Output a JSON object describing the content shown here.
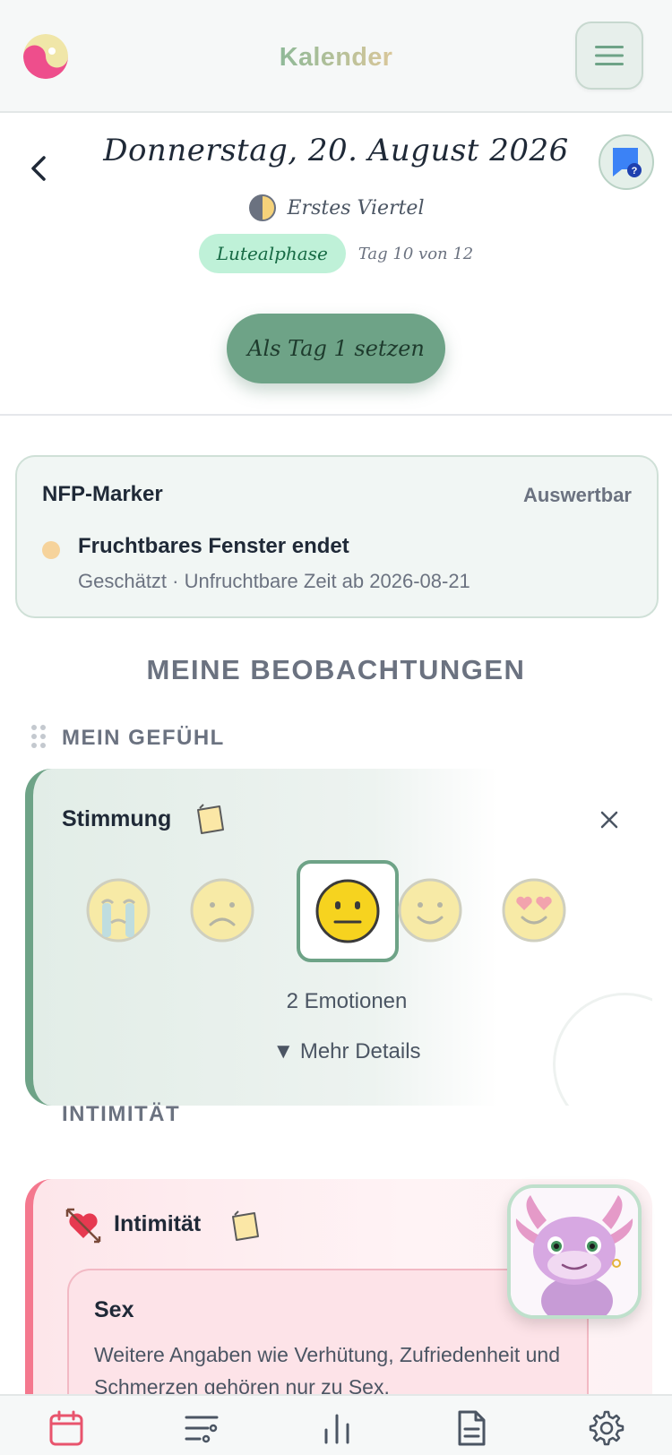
{
  "app": {
    "title": "Kalender"
  },
  "day": {
    "date": "Donnerstag, 20. August 2026",
    "moon_phase": "Erstes Viertel",
    "cycle_phase": "Lutealphase",
    "cycle_day": "Tag 10 von 12",
    "set_day1_label": "Als Tag 1 setzen"
  },
  "nfp": {
    "title": "NFP-Marker",
    "status": "Auswertbar",
    "event": "Fruchtbares Fenster endet",
    "detail": "Geschätzt · Unfruchtbare Zeit ab 2026-08-21"
  },
  "observations": {
    "heading": "MEINE BEOBACHTUNGEN",
    "feeling_section": "MEIN GEFÜHL",
    "mood": {
      "title": "Stimmung",
      "options": [
        "very-sad",
        "sad",
        "neutral",
        "happy",
        "in-love"
      ],
      "selected": "neutral",
      "emotion_count": "2 Emotionen",
      "more_details": "▼ Mehr Details"
    },
    "intimacy_section": "INTIMITÄT",
    "intimacy": {
      "title": "Intimität",
      "sex_title": "Sex",
      "sex_text": "Weitere Angaben wie Verhütung, Zufriedenheit und Schmerzen gehören nur zu Sex."
    }
  },
  "nav": {
    "items": [
      "calendar-icon",
      "filters-icon",
      "stats-icon",
      "document-icon",
      "settings-icon"
    ],
    "active": "calendar-icon"
  },
  "colors": {
    "accent_green": "#6ea387",
    "phase_badge_bg": "#bff1d8",
    "intimacy_accent": "#f4788e",
    "nav_active": "#e8546d"
  }
}
